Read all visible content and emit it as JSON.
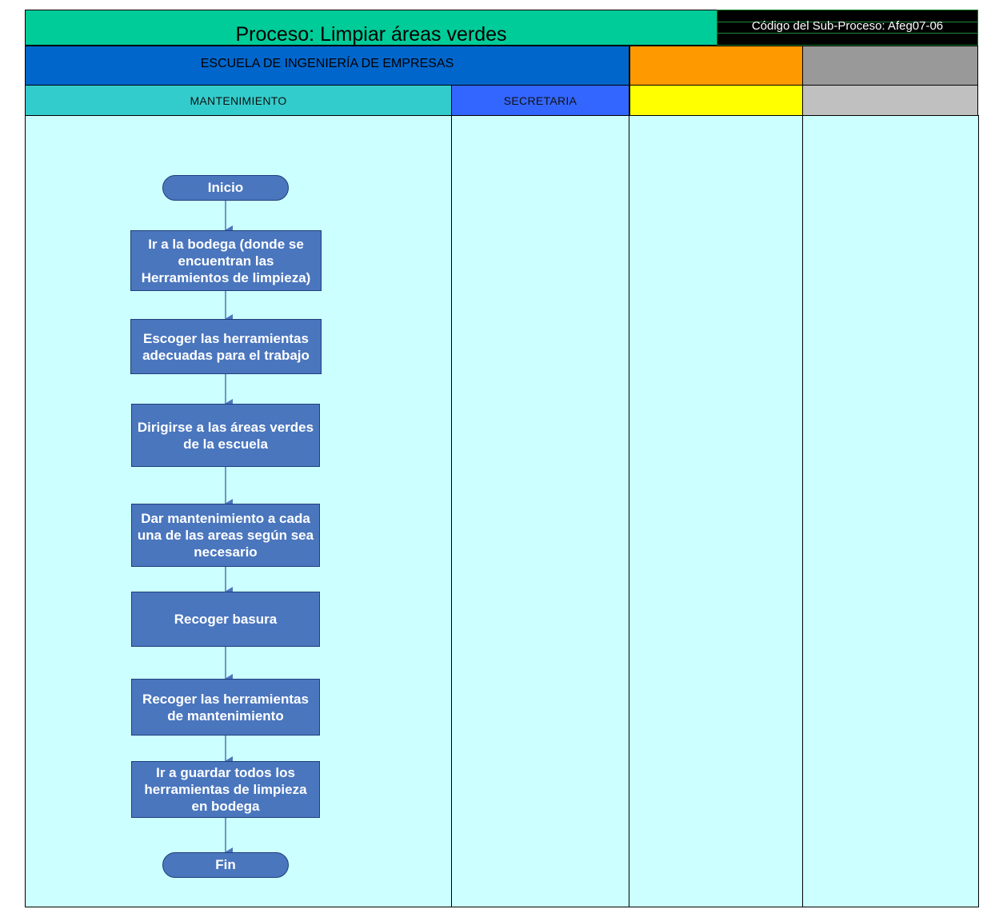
{
  "header": {
    "title": "Proceso: Limpiar áreas verdes",
    "code": "Código del Sub-Proceso: Afeg07-06",
    "organization": "ESCUELA DE INGENIERÍA DE EMPRESAS"
  },
  "lanes": [
    {
      "label": "MANTENIMIENTO",
      "color": "#33cccc"
    },
    {
      "label": "SECRETARIA",
      "color": "#3366ff"
    },
    {
      "label": "",
      "color": "#ffff00"
    },
    {
      "label": "",
      "color": "#c0c0c0"
    }
  ],
  "colors": {
    "title_bar": "#00cc99",
    "org_bar": "#0066cc",
    "org_orange": "#ff9900",
    "org_gray": "#999999",
    "lane_background": "#ccffff",
    "shape_fill": "#4a76be",
    "connector": "#4a76be"
  },
  "flow": {
    "start": "Inicio",
    "steps": [
      "Ir a la bodega (donde se encuentran las Herramientos de limpieza)",
      "Escoger las herramientas adecuadas para el trabajo",
      "Dirigirse a las áreas verdes de la escuela",
      "Dar mantenimiento a cada una de las areas según sea necesario",
      "Recoger basura",
      "Recoger las herramientas de mantenimiento",
      "Ir a guardar todos los herramientas de limpieza en bodega"
    ],
    "end": "Fin"
  }
}
